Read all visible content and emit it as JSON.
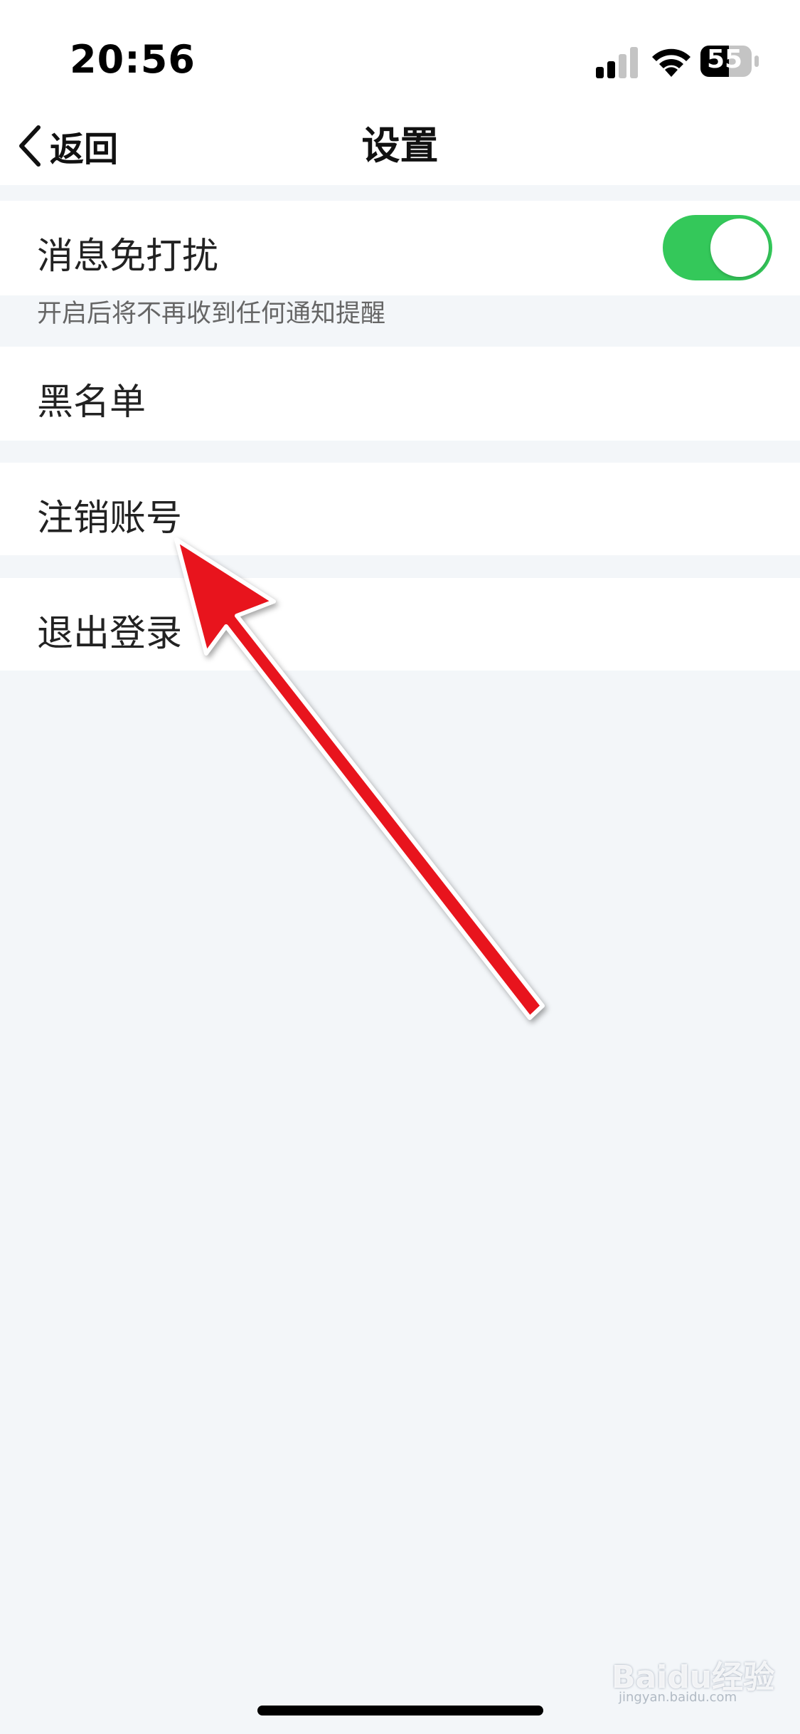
{
  "status_bar": {
    "time": "20:56",
    "battery": "55",
    "icons": [
      "signal-icon",
      "wifi-icon",
      "battery-icon"
    ]
  },
  "nav": {
    "back_label": "返回",
    "back_icon": "chevron-left-icon",
    "title": "设置"
  },
  "settings": {
    "dnd": {
      "label": "消息免打扰",
      "enabled": true,
      "hint": "开启后将不再收到任何通知提醒"
    },
    "blacklist_label": "黑名单",
    "cancel_account_label": "注销账号",
    "logout_label": "退出登录"
  },
  "overlay": {
    "arrow_color": "#e8141d",
    "points_to": "cancel_account"
  },
  "watermark": {
    "logo_text": "Baidu经验",
    "url": "jingyan.baidu.com"
  },
  "colors": {
    "toggle_on": "#34c85a",
    "page_background": "#f3f6f9",
    "cell_background": "#ffffff"
  }
}
